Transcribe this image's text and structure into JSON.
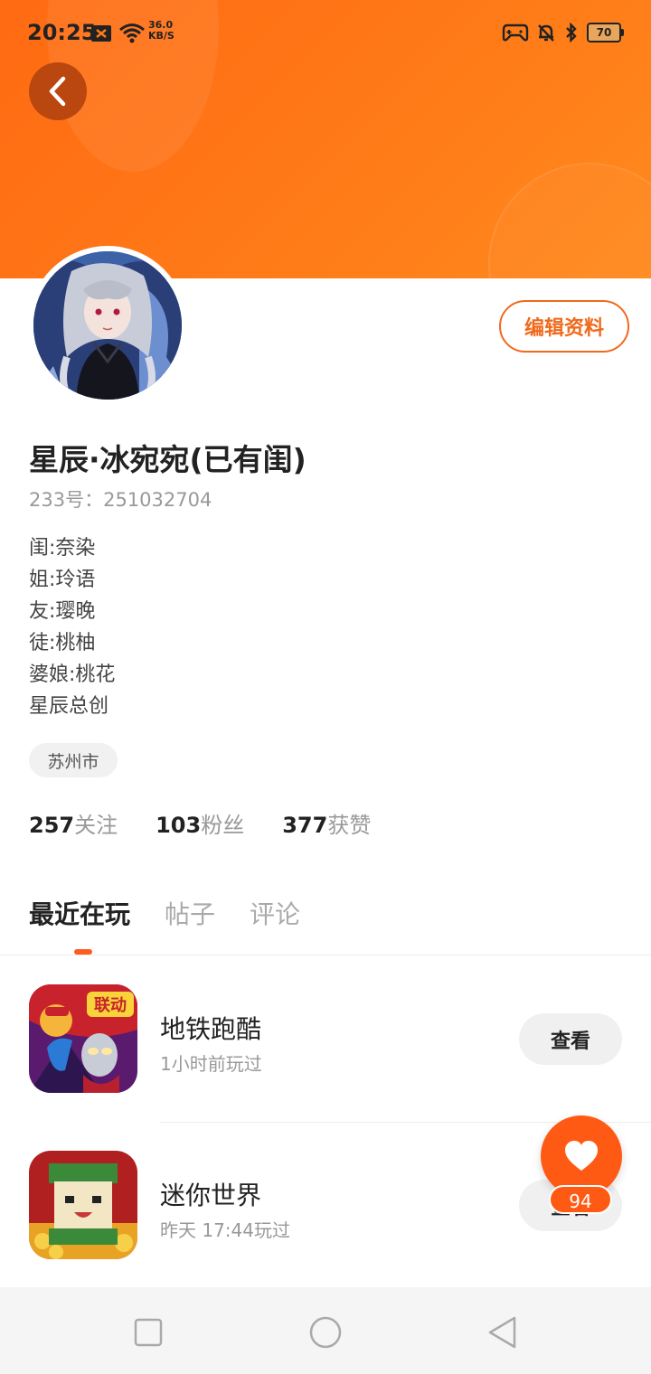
{
  "status_bar": {
    "time": "20:25",
    "net_speed_value": "36.0",
    "net_speed_unit": "KB/S",
    "battery": "70"
  },
  "profile": {
    "name": "星辰·冰宛宛(已有闺)",
    "uid": "233号：251032704",
    "bio": [
      "闺:奈染",
      "姐:玲语",
      "友:璎晚",
      "徒:桃柚",
      "婆娘:桃花",
      "星辰总创"
    ],
    "city": "苏州市",
    "edit_label": "编辑资料"
  },
  "stats": [
    {
      "count": "257",
      "label": "关注"
    },
    {
      "count": "103",
      "label": "粉丝"
    },
    {
      "count": "377",
      "label": "获赞"
    }
  ],
  "tabs": [
    "最近在玩",
    "帖子",
    "评论"
  ],
  "games": [
    {
      "name": "地铁跑酷",
      "time": "1小时前玩过",
      "button": "查看",
      "icon_badge": "联动"
    },
    {
      "name": "迷你世界",
      "time": "昨天 17:44玩过",
      "button": "查看"
    }
  ],
  "like": {
    "count": "94"
  },
  "colors": {
    "brand": "#ff6a12",
    "accent": "#f06a1c"
  }
}
